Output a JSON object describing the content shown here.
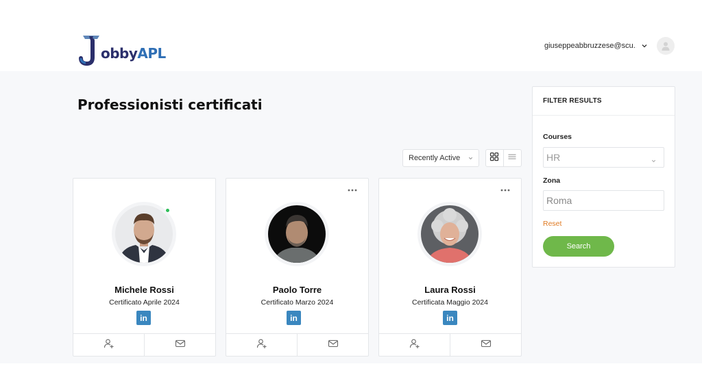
{
  "brand": {
    "logo_letter": "J",
    "name_part1": "obby",
    "name_part2": "APL"
  },
  "user": {
    "email": "giuseppeabbruzzese@scu..."
  },
  "page": {
    "title": "Professionisti certificati"
  },
  "toolbar": {
    "sort_value": "Recently Active"
  },
  "members": [
    {
      "name": "Michele Rossi",
      "certification": "Certificato Aprile 2024",
      "linkedin_label": "in",
      "online": true
    },
    {
      "name": "Paolo Torre",
      "certification": "Certificato Marzo 2024",
      "linkedin_label": "in",
      "online": false
    },
    {
      "name": "Laura Rossi",
      "certification": "Certificata Maggio 2024",
      "linkedin_label": "in",
      "online": false
    }
  ],
  "filters": {
    "title": "FILTER RESULTS",
    "courses_label": "Courses",
    "courses_value": "HR",
    "zona_label": "Zona",
    "zona_value": "Roma",
    "reset_label": "Reset",
    "search_label": "Search"
  },
  "colors": {
    "brand_dark": "#2b2f6b",
    "brand_blue": "#2f6fb5",
    "search_button": "#6fb84a",
    "reset_link": "#e07a22",
    "linkedin": "#3a87bf",
    "online": "#2ebd59"
  },
  "icons": {
    "card_menu": "more-horizontal-icon",
    "add_friend": "user-plus-icon",
    "message": "mail-icon",
    "grid_view": "grid-icon",
    "list_view": "list-icon",
    "user_menu": "chevron-down-icon",
    "avatar": "user-avatar-icon"
  }
}
